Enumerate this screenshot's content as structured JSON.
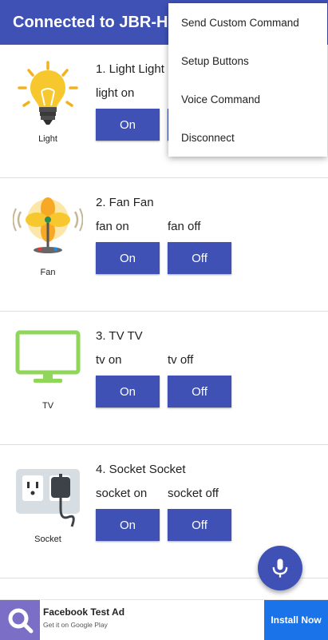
{
  "appbar": {
    "title": "Connected to JBR-HC"
  },
  "menu": {
    "items": [
      {
        "label": "Send Custom Command"
      },
      {
        "label": "Setup Buttons"
      },
      {
        "label": "Voice Command"
      },
      {
        "label": "Disconnect"
      }
    ]
  },
  "devices": [
    {
      "icon": "light-bulb-icon",
      "caption": "Light",
      "title": "1. Light Light",
      "on_label": "light on",
      "off_label": "",
      "on_button": "On",
      "off_button": ""
    },
    {
      "icon": "fan-icon",
      "caption": "Fan",
      "title": "2. Fan Fan",
      "on_label": "fan on",
      "off_label": "fan off",
      "on_button": "On",
      "off_button": "Off"
    },
    {
      "icon": "tv-icon",
      "caption": "TV",
      "title": "3. TV TV",
      "on_label": "tv on",
      "off_label": "tv off",
      "on_button": "On",
      "off_button": "Off"
    },
    {
      "icon": "socket-icon",
      "caption": "Socket",
      "title": "4. Socket Socket",
      "on_label": "socket on",
      "off_label": "socket off",
      "on_button": "On",
      "off_button": "Off"
    }
  ],
  "fab": {
    "icon": "microphone-icon"
  },
  "ad": {
    "title": "Facebook Test Ad",
    "subtitle": "Get it on Google Play",
    "button": "Install Now"
  },
  "colors": {
    "primary": "#3f51b5",
    "install_button": "#1a73e8",
    "tv_green": "#8fd65a",
    "bulb_yellow": "#f7c82e"
  }
}
